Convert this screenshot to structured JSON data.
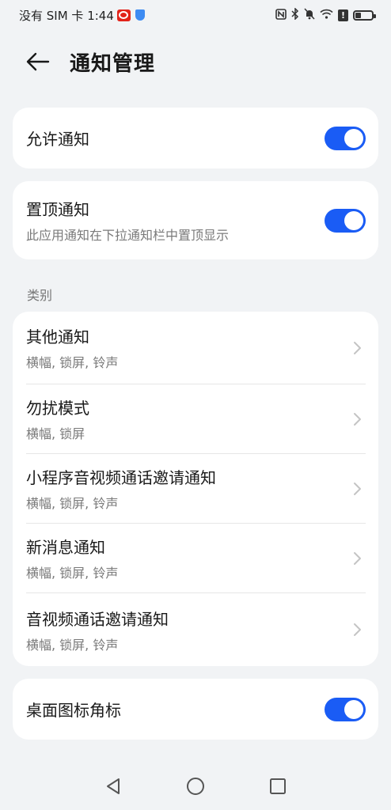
{
  "status_bar": {
    "carrier_time": "没有 SIM 卡 1:44",
    "icons": [
      "app-notification-icon",
      "shield-icon",
      "nfc-icon",
      "bluetooth-icon",
      "mute-icon",
      "wifi-icon",
      "alert-icon",
      "battery-icon"
    ]
  },
  "header": {
    "back_icon": "back-arrow-icon",
    "title": "通知管理"
  },
  "allow_notifications": {
    "label": "允许通知",
    "enabled": true
  },
  "pin_notifications": {
    "label": "置顶通知",
    "description": "此应用通知在下拉通知栏中置顶显示",
    "enabled": true
  },
  "categories": {
    "label": "类别",
    "items": [
      {
        "title": "其他通知",
        "subtitle": "横幅, 锁屏, 铃声"
      },
      {
        "title": "勿扰模式",
        "subtitle": "横幅, 锁屏"
      },
      {
        "title": "小程序音视频通话邀请通知",
        "subtitle": "横幅, 锁屏, 铃声"
      },
      {
        "title": "新消息通知",
        "subtitle": "横幅, 锁屏, 铃声"
      },
      {
        "title": "音视频通话邀请通知",
        "subtitle": "横幅, 锁屏, 铃声"
      }
    ]
  },
  "badge": {
    "label": "桌面图标角标",
    "enabled": true
  },
  "nav_bar": {
    "icons": [
      "back-triangle-icon",
      "home-circle-icon",
      "recents-square-icon"
    ]
  },
  "colors": {
    "accent": "#1a5cf5",
    "background": "#f1f3f5",
    "card": "#ffffff",
    "secondary_text": "#7a7a7a"
  }
}
